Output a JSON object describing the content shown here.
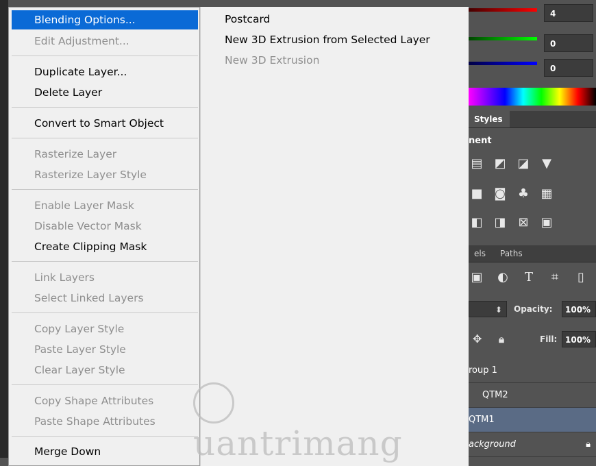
{
  "context_menu": {
    "items": [
      {
        "label": "Blending Options...",
        "state": "highlighted"
      },
      {
        "label": "Edit Adjustment...",
        "state": "disabled"
      },
      {
        "label": "Duplicate Layer...",
        "state": "enabled"
      },
      {
        "label": "Delete Layer",
        "state": "enabled"
      },
      {
        "label": "Convert to Smart Object",
        "state": "enabled"
      },
      {
        "label": "Rasterize Layer",
        "state": "disabled"
      },
      {
        "label": "Rasterize Layer Style",
        "state": "disabled"
      },
      {
        "label": "Enable Layer Mask",
        "state": "disabled"
      },
      {
        "label": "Disable Vector Mask",
        "state": "disabled"
      },
      {
        "label": "Create Clipping Mask",
        "state": "enabled"
      },
      {
        "label": "Link Layers",
        "state": "disabled"
      },
      {
        "label": "Select Linked Layers",
        "state": "disabled"
      },
      {
        "label": "Copy Layer Style",
        "state": "disabled"
      },
      {
        "label": "Paste Layer Style",
        "state": "disabled"
      },
      {
        "label": "Clear Layer Style",
        "state": "disabled"
      },
      {
        "label": "Copy Shape Attributes",
        "state": "disabled"
      },
      {
        "label": "Paste Shape Attributes",
        "state": "disabled"
      },
      {
        "label": "Merge Down",
        "state": "enabled"
      }
    ]
  },
  "submenu": {
    "items": [
      {
        "label": "Postcard",
        "state": "enabled"
      },
      {
        "label": "New 3D Extrusion from Selected Layer",
        "state": "enabled"
      },
      {
        "label": "New 3D Extrusion",
        "state": "disabled"
      }
    ]
  },
  "color_panel": {
    "red_value": "4",
    "green_value": "0",
    "blue_value": "0"
  },
  "styles_tab": {
    "label": "Styles"
  },
  "adjustments_title": "nent",
  "layers_tabs": {
    "channels": "els",
    "paths": "Paths"
  },
  "layers_panel": {
    "opacity_label": "Opacity:",
    "opacity_value": "100%",
    "fill_label": "Fill:",
    "fill_value": "100%",
    "layers": [
      {
        "name": "roup 1"
      },
      {
        "name": "QTM2"
      },
      {
        "name": "QTM1"
      },
      {
        "name": "ackground"
      }
    ]
  },
  "watermark": "uantrimang",
  "colors": {
    "highlight": "#0a6ad6",
    "menu_bg": "#f0f0f0",
    "panel_bg": "#535353",
    "selected_layer": "#5a6b85"
  }
}
